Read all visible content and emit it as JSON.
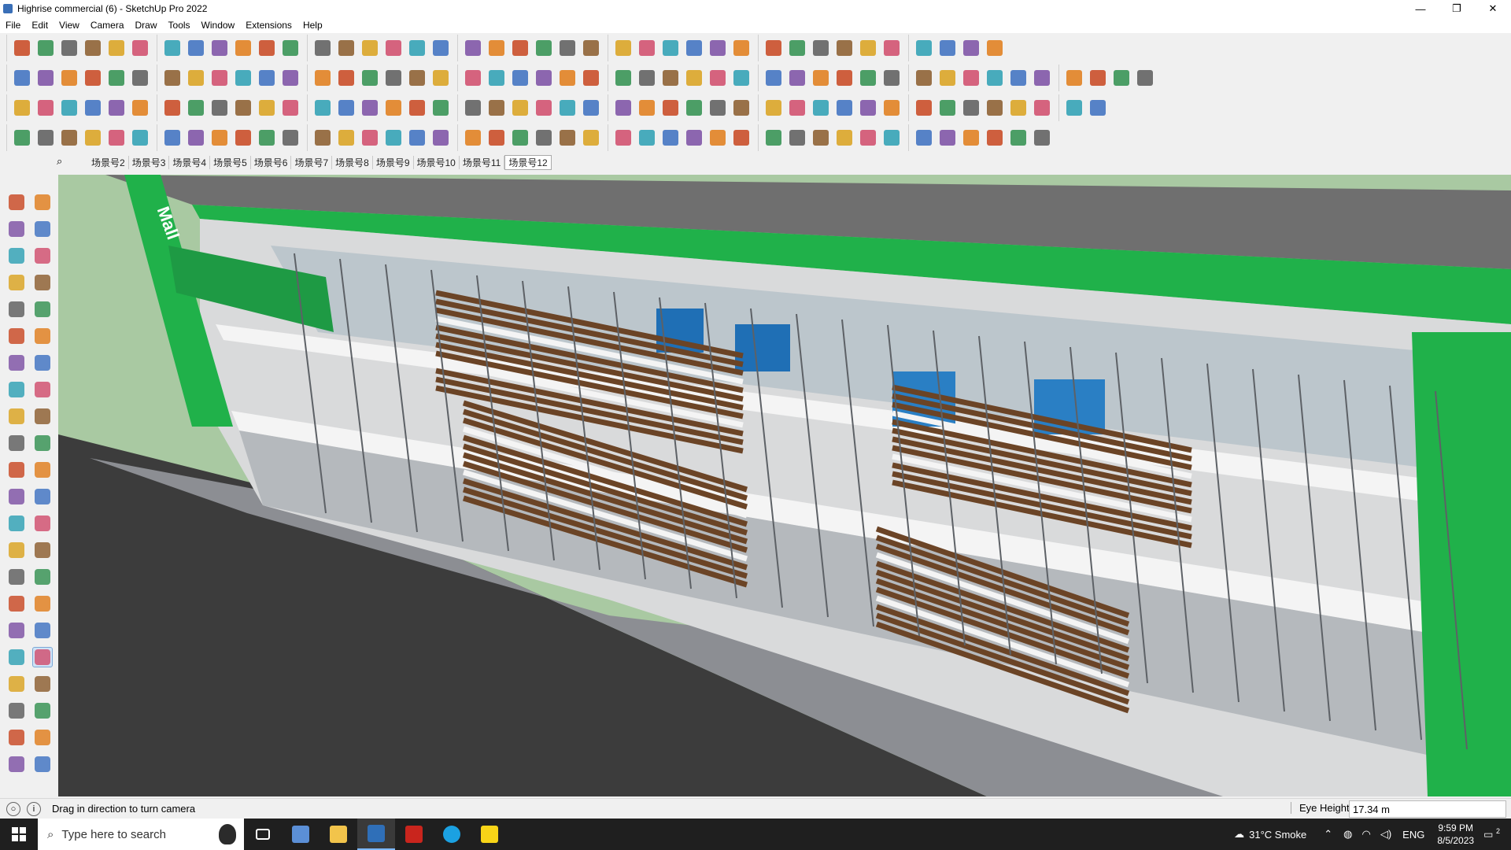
{
  "window": {
    "title": "Highrise commercial (6) - SketchUp Pro 2022",
    "controls": [
      "—",
      "❐",
      "✕"
    ]
  },
  "menu": [
    "File",
    "Edit",
    "View",
    "Camera",
    "Draw",
    "Tools",
    "Window",
    "Extensions",
    "Help"
  ],
  "scenes": {
    "search_icon": "search-icon",
    "tabs": [
      "场景号2",
      "场景号3",
      "场景号4",
      "场景号5",
      "场景号6",
      "场景号7",
      "场景号8",
      "场景号9",
      "场景号10",
      "场景号11",
      "场景号12"
    ],
    "active": "场景号12"
  },
  "viewport": {
    "sign_text": "Mall"
  },
  "status": {
    "message": "Drag in direction to turn camera",
    "measure_label": "Eye Height",
    "measure_value": "17.34 m"
  },
  "taskbar": {
    "search_placeholder": "Type here to search",
    "weather": "31°C  Smoke",
    "language": "ENG",
    "time": "9:59 PM",
    "date": "8/5/2023",
    "notifications": "2"
  },
  "colors": {
    "accent_green": "#20b14a",
    "wood": "#6b4426",
    "sky": "#a9c9a2",
    "ground": "#8e9196"
  }
}
